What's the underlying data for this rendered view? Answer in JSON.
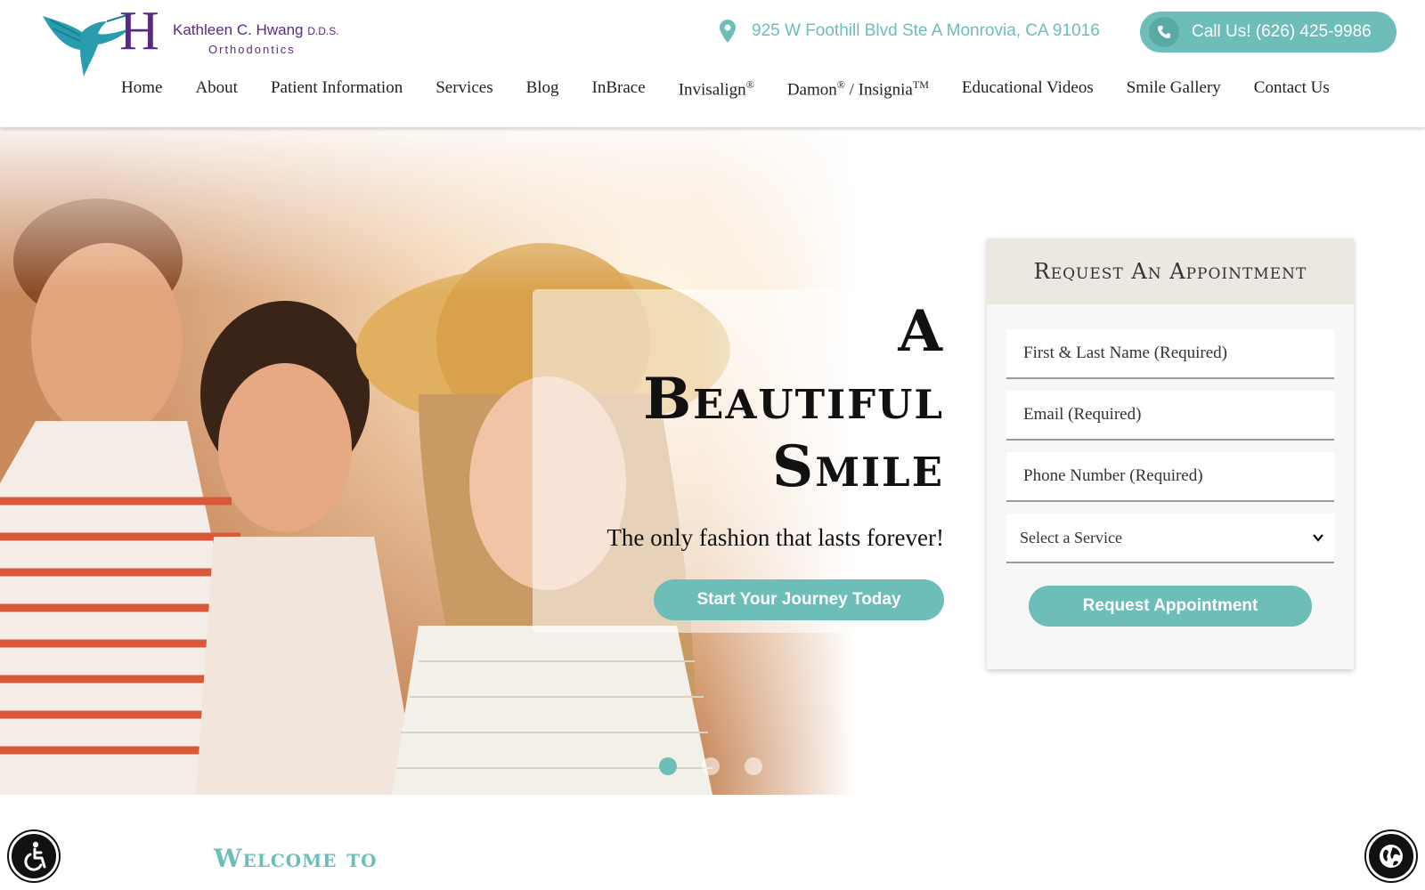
{
  "brand": {
    "logo_letter": "H",
    "practice_name": "Kathleen C. Hwang",
    "credentials": "D.D.S.",
    "specialty": "Orthodontics"
  },
  "header": {
    "address": "925 W Foothill Blvd Ste A Monrovia, CA 91016",
    "call_label": "Call Us! (626) 425-9986",
    "icons": {
      "address": "map-pin-icon",
      "call": "phone-icon"
    }
  },
  "nav": {
    "home": "Home",
    "about": "About",
    "patient_info": "Patient Information",
    "services": "Services",
    "blog": "Blog",
    "inbrace": "InBrace",
    "invisalign": "Invisalign",
    "invisalign_mark": "®",
    "damon": "Damon",
    "damon_mark": "®",
    "insignia_sep": " / Insignia",
    "insignia_mark": "TM",
    "videos": "Educational Videos",
    "gallery": "Smile Gallery",
    "contact": "Contact Us"
  },
  "hero": {
    "title_line1": "A",
    "title_line2": "Beautiful",
    "title_line3": "Smile",
    "subtitle": "The only fashion that lasts forever!",
    "cta_label": "Start Your Journey Today",
    "slides_total": 3,
    "slide_active": 1
  },
  "appointment": {
    "heading": "Request An Appointment",
    "name_placeholder": "First & Last Name (Required)",
    "email_placeholder": "Email (Required)",
    "phone_placeholder": "Phone Number (Required)",
    "service_selected": "Select a Service",
    "submit_label": "Request Appointment"
  },
  "welcome": {
    "heading": "Welcome to"
  },
  "widgets": {
    "accessibility": "accessibility-icon",
    "language": "globe-icon"
  },
  "colors": {
    "accent": "#6dbdb8",
    "brand_purple": "#5a2a82",
    "form_header": "#eae8e0"
  }
}
